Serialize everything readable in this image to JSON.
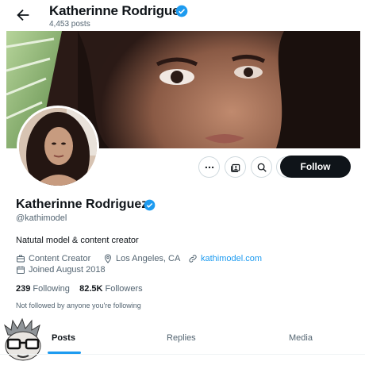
{
  "header": {
    "name": "Katherinne Rodriguez",
    "posts_count": "4,453 posts"
  },
  "profile": {
    "name": "Katherinne Rodriguez",
    "handle": "@kathimodel",
    "bio": "Natutal model & content creator",
    "category": "Content Creator",
    "location": "Los Angeles, CA",
    "website": "kathimodel.com",
    "joined": "Joined August 2018",
    "following_count": "239",
    "following_label": "Following",
    "followers_count": "82.5K",
    "followers_label": "Followers",
    "not_followed_text": "Not followed by anyone you're following"
  },
  "actions": {
    "follow_label": "Follow"
  },
  "tabs": [
    {
      "label": "Posts",
      "active": true
    },
    {
      "label": "Replies",
      "active": false
    },
    {
      "label": "Media",
      "active": false
    }
  ],
  "colors": {
    "accent": "#1d9bf0",
    "text": "#0f1419",
    "secondary": "#536471",
    "follow_bg": "#0f1419"
  },
  "icons": {
    "back": "arrow-left-icon",
    "verified": "verified-badge-icon",
    "more": "more-icon",
    "subscribe": "subscribe-icon",
    "search": "search-icon",
    "message": "message-icon",
    "category": "briefcase-icon",
    "location": "location-pin-icon",
    "link": "link-icon",
    "calendar": "calendar-icon"
  }
}
